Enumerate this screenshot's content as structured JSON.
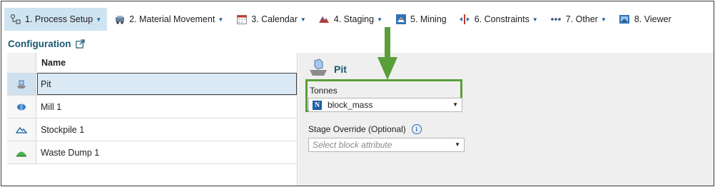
{
  "toolbar": {
    "items": [
      {
        "label": "1. Process Setup",
        "icon": "process-setup-icon",
        "dropdown": true,
        "active": true
      },
      {
        "label": "2. Material Movement",
        "icon": "material-movement-icon",
        "dropdown": true
      },
      {
        "label": "3. Calendar",
        "icon": "calendar-icon",
        "dropdown": true
      },
      {
        "label": "4. Staging",
        "icon": "staging-icon",
        "dropdown": true
      },
      {
        "label": "5. Mining",
        "icon": "mining-icon",
        "dropdown": false
      },
      {
        "label": "6. Constraints",
        "icon": "constraints-icon",
        "dropdown": true
      },
      {
        "label": "7. Other",
        "icon": "more-dots-icon",
        "dropdown": true
      },
      {
        "label": "8. Viewer",
        "icon": "viewer-icon",
        "dropdown": false
      }
    ]
  },
  "config": {
    "title": "Configuration",
    "column_header": "Name",
    "rows": [
      {
        "label": "Pit",
        "icon": "pit-icon",
        "selected": true
      },
      {
        "label": "Mill 1",
        "icon": "mill-icon"
      },
      {
        "label": "Stockpile 1",
        "icon": "stockpile-icon"
      },
      {
        "label": "Waste Dump 1",
        "icon": "waste-dump-icon"
      }
    ]
  },
  "details": {
    "title": "Pit",
    "tonnes_label": "Tonnes",
    "tonnes_value": "block_mass",
    "tonnes_badge": "N",
    "stage_label": "Stage Override (Optional)",
    "info_glyph": "i",
    "stage_placeholder": "Select block attribute"
  },
  "colors": {
    "accent_active": "#cfe4f1",
    "highlight_green": "#5a9e3a",
    "title_teal": "#1a5a70"
  }
}
